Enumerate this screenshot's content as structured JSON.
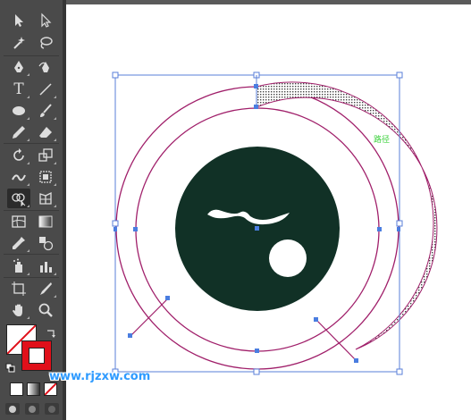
{
  "topbar": {
    "text": ""
  },
  "toolbox": {
    "tools": [
      {
        "name": "selection-tool"
      },
      {
        "name": "direct-selection-tool"
      },
      {
        "name": "magic-wand-tool"
      },
      {
        "name": "lasso-tool"
      },
      {
        "name": "pen-tool"
      },
      {
        "name": "curvature-tool"
      },
      {
        "name": "type-tool"
      },
      {
        "name": "line-segment-tool"
      },
      {
        "name": "ellipse-tool"
      },
      {
        "name": "paintbrush-tool"
      },
      {
        "name": "pencil-tool"
      },
      {
        "name": "eraser-tool"
      },
      {
        "name": "rotate-tool"
      },
      {
        "name": "scale-tool"
      },
      {
        "name": "width-tool"
      },
      {
        "name": "free-transform-tool"
      },
      {
        "name": "shape-builder-tool"
      },
      {
        "name": "perspective-grid-tool"
      },
      {
        "name": "mesh-tool"
      },
      {
        "name": "gradient-tool"
      },
      {
        "name": "eyedropper-tool"
      },
      {
        "name": "blend-tool"
      },
      {
        "name": "symbol-sprayer-tool"
      },
      {
        "name": "column-graph-tool"
      },
      {
        "name": "artboard-tool"
      },
      {
        "name": "slice-tool"
      },
      {
        "name": "hand-tool"
      },
      {
        "name": "zoom-tool"
      }
    ],
    "type_label": "T"
  },
  "colors": {
    "fill": "#ffffff",
    "stroke": "#e0101a",
    "dark_circle": "#113126",
    "ring_stroke": "#a01f6a",
    "selection": "#4a7de0"
  },
  "canvas": {
    "path_label": "路径"
  },
  "watermark": "www.rjzxw.com"
}
